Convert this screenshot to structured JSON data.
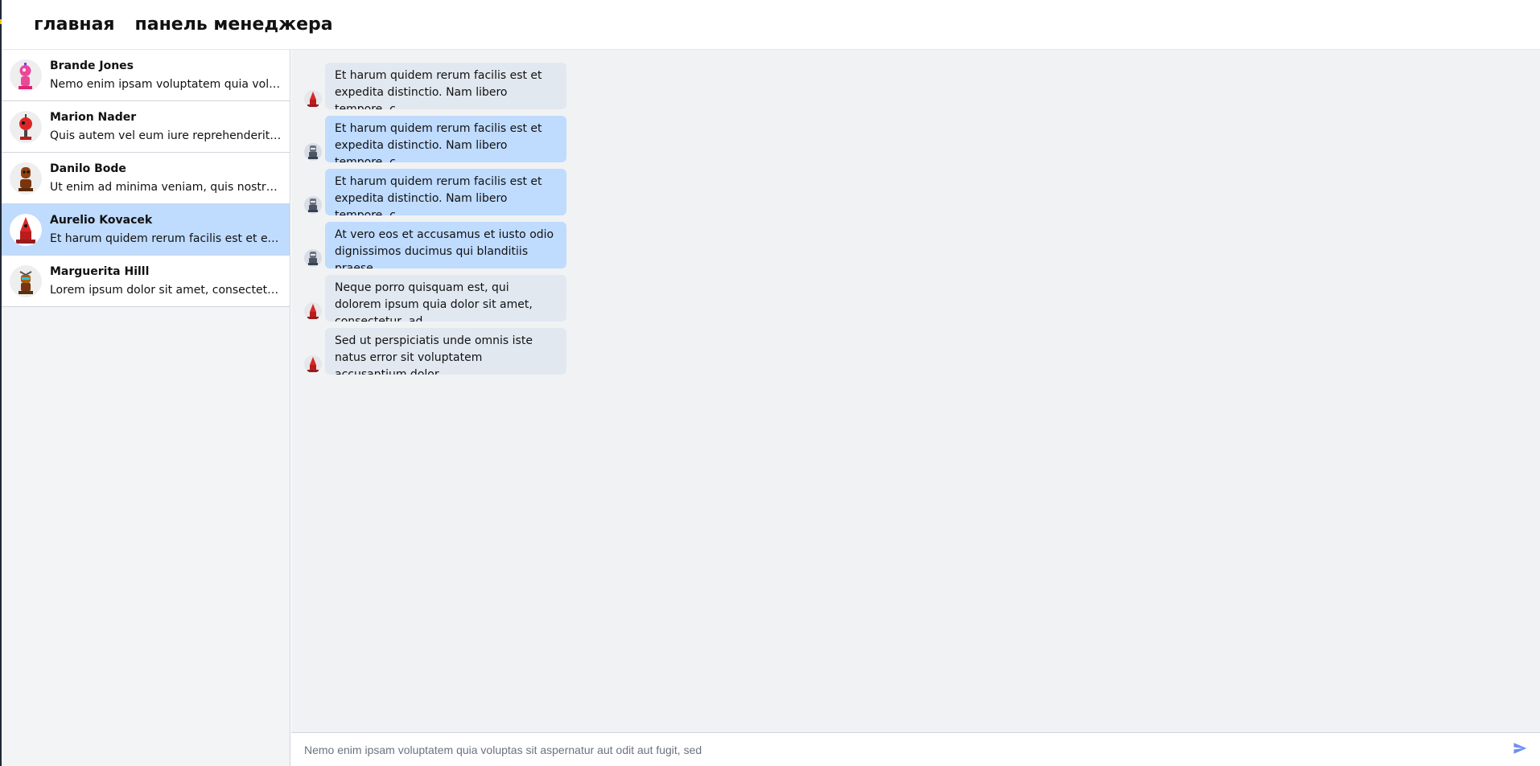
{
  "nav": {
    "home": "главная",
    "manager_panel": "панель менеджера"
  },
  "contacts": [
    {
      "name": "Brande Jones",
      "preview": "Nemo enim ipsam voluptatem quia voluptas sit aspernatur",
      "avatar": "pink-robot-avatar"
    },
    {
      "name": "Marion Nader",
      "preview": "Quis autem vel eum iure reprehenderit qui in ea voluptate",
      "avatar": "red-robot-avatar"
    },
    {
      "name": "Danilo Bode",
      "preview": "Ut enim ad minima veniam, quis nostrum exercitationem",
      "avatar": "brown-robot-avatar"
    },
    {
      "name": "Aurelio Kovacek",
      "preview": "Et harum quidem rerum facilis est et expedita distinctio",
      "avatar": "red-cone-robot-avatar",
      "active": true
    },
    {
      "name": "Marguerita Hilll",
      "preview": "Lorem ipsum dolor sit amet, consectetur adipiscing elit",
      "avatar": "bird-robot-avatar"
    }
  ],
  "messages": [
    {
      "text": "Et harum quidem rerum facilis est et expedita distinctio. Nam libero tempore, c",
      "own": false,
      "avatar": "red-cone-robot-avatar"
    },
    {
      "text": "Et harum quidem rerum facilis est et expedita distinctio. Nam libero tempore, c",
      "own": true,
      "avatar": "grey-robot-avatar"
    },
    {
      "text": "Et harum quidem rerum facilis est et expedita distinctio. Nam libero tempore, c",
      "own": true,
      "avatar": "grey-robot-avatar"
    },
    {
      "text": "At vero eos et accusamus et iusto odio dignissimos ducimus qui blanditiis praese",
      "own": true,
      "avatar": "grey-robot-avatar"
    },
    {
      "text": "Neque porro quisquam est, qui dolorem ipsum quia dolor sit amet, consectetur, ad",
      "own": false,
      "avatar": "red-cone-robot-avatar"
    },
    {
      "text": "Sed ut perspiciatis unde omnis iste natus error sit voluptatem accusantium dolor",
      "own": false,
      "avatar": "red-cone-robot-avatar"
    }
  ],
  "composer": {
    "value": "Nemo enim ipsam voluptatem quia voluptas sit aspernatur aut odit aut fugit, sed",
    "send_icon": "paper-plane-icon"
  },
  "colors": {
    "active_contact": "#bfdbfe",
    "own_bubble": "#bfdbfe",
    "other_bubble": "#e2e8f0",
    "chat_bg": "#f1f2f4",
    "send_icon": "#6b8df5"
  }
}
